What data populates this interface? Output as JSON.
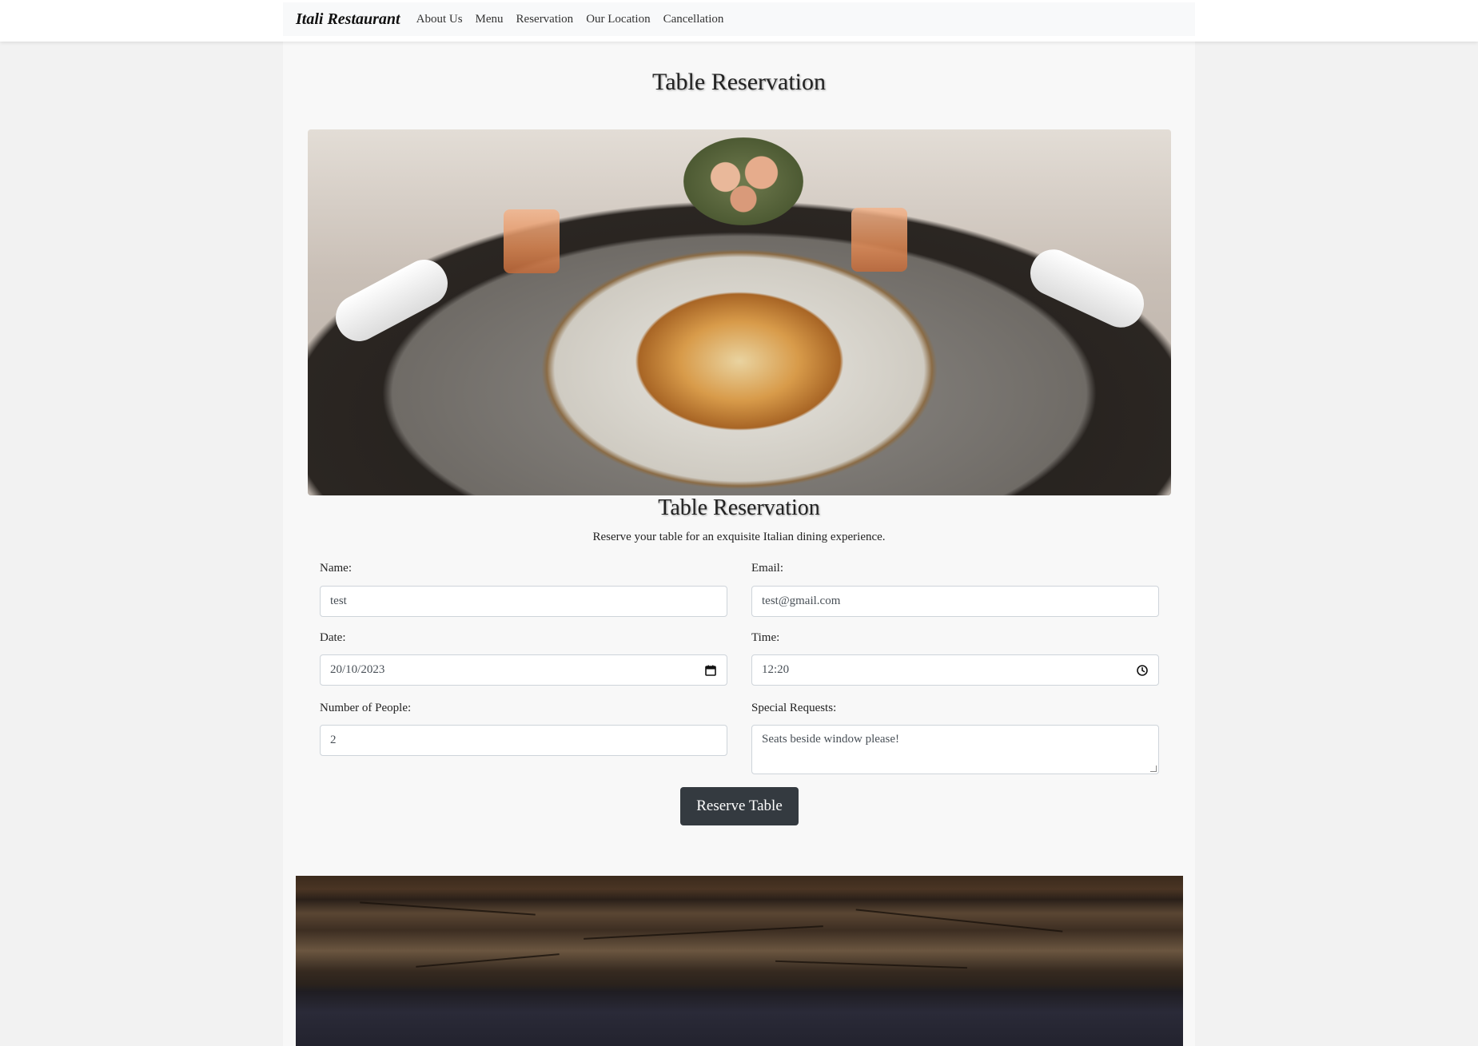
{
  "navbar": {
    "brand": "Itali Restaurant",
    "links": [
      "About Us",
      "Menu",
      "Reservation",
      "Our Location",
      "Cancellation"
    ]
  },
  "page": {
    "title": "Table Reservation"
  },
  "form": {
    "heading": "Table Reservation",
    "intro": "Reserve your table for an exquisite Italian dining experience.",
    "name": {
      "label": "Name:",
      "value": "test"
    },
    "email": {
      "label": "Email:",
      "value": "test@gmail.com"
    },
    "date": {
      "label": "Date:",
      "value": "20/10/2023",
      "icon": "calendar-icon"
    },
    "time": {
      "label": "Time:",
      "value": "12:20",
      "icon": "clock-icon"
    },
    "people": {
      "label": "Number of People:",
      "value": "2"
    },
    "requests": {
      "label": "Special Requests:",
      "value": "Seats beside window please!"
    },
    "submit_label": "Reserve Table"
  },
  "colors": {
    "button_bg": "#343a40",
    "page_bg": "#f2f2f2",
    "panel_bg": "#f8f8f8"
  }
}
